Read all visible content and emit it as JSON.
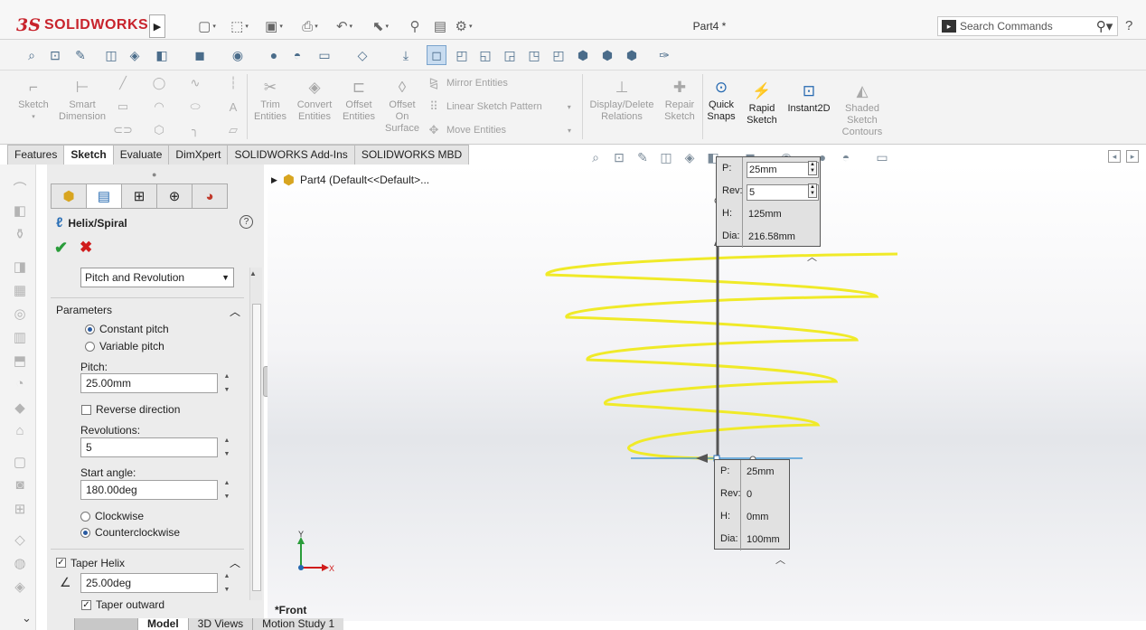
{
  "app": {
    "brand_ds": "3S",
    "brand_name": "SOLIDWORKS",
    "document_title": "Part4 *"
  },
  "search": {
    "placeholder": "Search Commands",
    "icon": "magnifier-icon"
  },
  "help_icon": "?",
  "command_manager": {
    "sketch": "Sketch",
    "smart_dimension": [
      "Smart",
      "Dimension"
    ],
    "trim_entities": [
      "Trim",
      "Entities"
    ],
    "convert_entities": [
      "Convert",
      "Entities"
    ],
    "offset_entities": [
      "Offset",
      "Entities"
    ],
    "offset_on_surface": [
      "Offset",
      "On",
      "Surface"
    ],
    "mirror_entities": "Mirror Entities",
    "linear_sketch_pattern": "Linear Sketch Pattern",
    "move_entities": "Move Entities",
    "display_delete_relations": [
      "Display/Delete",
      "Relations"
    ],
    "repair_sketch": [
      "Repair",
      "Sketch"
    ],
    "quick_snaps": [
      "Quick",
      "Snaps"
    ],
    "rapid_sketch": [
      "Rapid",
      "Sketch"
    ],
    "instant2d": "Instant2D",
    "shaded_sketch_contours": [
      "Shaded",
      "Sketch",
      "Contours"
    ]
  },
  "tabs": [
    "Features",
    "Sketch",
    "Evaluate",
    "DimXpert",
    "SOLIDWORKS Add-Ins",
    "SOLIDWORKS MBD"
  ],
  "active_tab": "Sketch",
  "tree": {
    "part_label": "Part4  (Default<<Default>..."
  },
  "property_manager": {
    "title": "Helix/Spiral",
    "defined_by": "Pitch and Revolution",
    "parameters_header": "Parameters",
    "constant_pitch": "Constant pitch",
    "variable_pitch": "Variable pitch",
    "pitch_label": "Pitch:",
    "pitch_value": "25.00mm",
    "reverse_direction": "Reverse direction",
    "revolutions_label": "Revolutions:",
    "revolutions_value": "5",
    "start_angle_label": "Start angle:",
    "start_angle_value": "180.00deg",
    "clockwise": "Clockwise",
    "counterclockwise": "Counterclockwise",
    "taper_helix": "Taper Helix",
    "taper_value": "25.00deg",
    "taper_outward": "Taper outward",
    "selected_pitch_mode": "Constant pitch",
    "selected_direction": "Counterclockwise",
    "reverse_checked": false,
    "taper_checked": true,
    "taper_outward_checked": true
  },
  "top_callout": {
    "p_label": "P:",
    "p_value": "25mm",
    "rev_label": "Rev:",
    "rev_value": "5",
    "h_label": "H:",
    "h_value": "125mm",
    "dia_label": "Dia:",
    "dia_value": "216.58mm"
  },
  "bottom_callout": {
    "p_label": "P:",
    "p_value": "25mm",
    "rev_label": "Rev:",
    "rev_value": "0",
    "h_label": "H:",
    "h_value": "0mm",
    "dia_label": "Dia:",
    "dia_value": "100mm"
  },
  "triad": {
    "x": "X",
    "y": "Y"
  },
  "view_label": "*Front",
  "bottom_tabs": [
    "Model",
    "3D Views",
    "Motion Study 1"
  ],
  "colors": {
    "helix": "#f0ea28",
    "accent": "#2468b0",
    "brand": "#c8232c"
  }
}
